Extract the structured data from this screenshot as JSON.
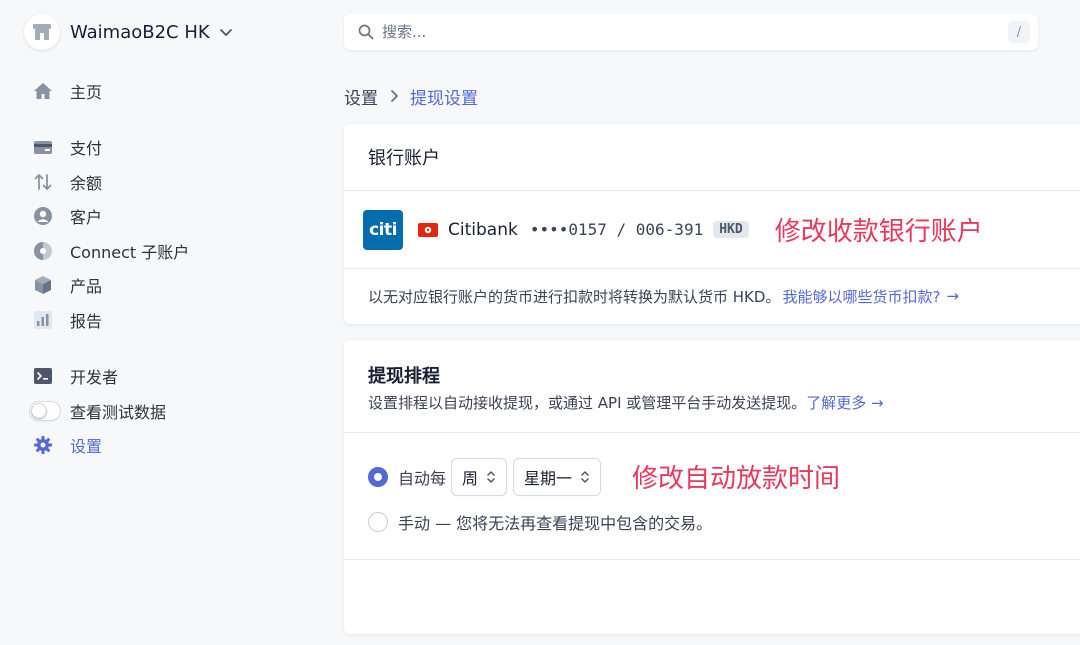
{
  "account": {
    "name": "WaimaoB2C HK"
  },
  "search": {
    "placeholder": "搜索...",
    "shortcut": "/"
  },
  "sidebar": {
    "items": [
      {
        "label": "主页",
        "icon": "home-icon"
      },
      {
        "label": "支付",
        "icon": "payments-icon"
      },
      {
        "label": "余额",
        "icon": "balance-arrows-icon"
      },
      {
        "label": "客户",
        "icon": "customer-icon"
      },
      {
        "label": "Connect 子账户",
        "icon": "connect-icon"
      },
      {
        "label": "产品",
        "icon": "product-box-icon"
      },
      {
        "label": "报告",
        "icon": "report-chart-icon"
      },
      {
        "label": "开发者",
        "icon": "terminal-icon"
      },
      {
        "label": "查看测试数据",
        "icon": "toggle-switch"
      },
      {
        "label": "设置",
        "icon": "gear-icon",
        "active": true
      }
    ]
  },
  "breadcrumb": {
    "parent": "设置",
    "current": "提现设置"
  },
  "bank_card": {
    "title": "银行账户",
    "bank_logo_text": "citi",
    "bank_name": "Citibank",
    "account_number": "••••0157 / 006-391",
    "currency": "HKD",
    "annotation": "修改收款银行账户",
    "note": "以无对应银行账户的货币进行扣款时将转换为默认货币 HKD。",
    "note_link": "我能够以哪些货币扣款?",
    "note_arrow": "→"
  },
  "schedule_card": {
    "title": "提现排程",
    "description": "设置排程以自动接收提现，或通过 API 或管理平台手动发送提现。",
    "learn_more": "了解更多 →",
    "auto_label": "自动每",
    "period_select": "周",
    "day_select": "星期一",
    "annotation": "修改自动放款时间",
    "manual_label": "手动 — 您将无法再查看提现中包含的交易。",
    "selected": "auto"
  },
  "colors": {
    "accent": "#5469d4",
    "annotation": "#e8385c",
    "citi": "#056dae"
  }
}
